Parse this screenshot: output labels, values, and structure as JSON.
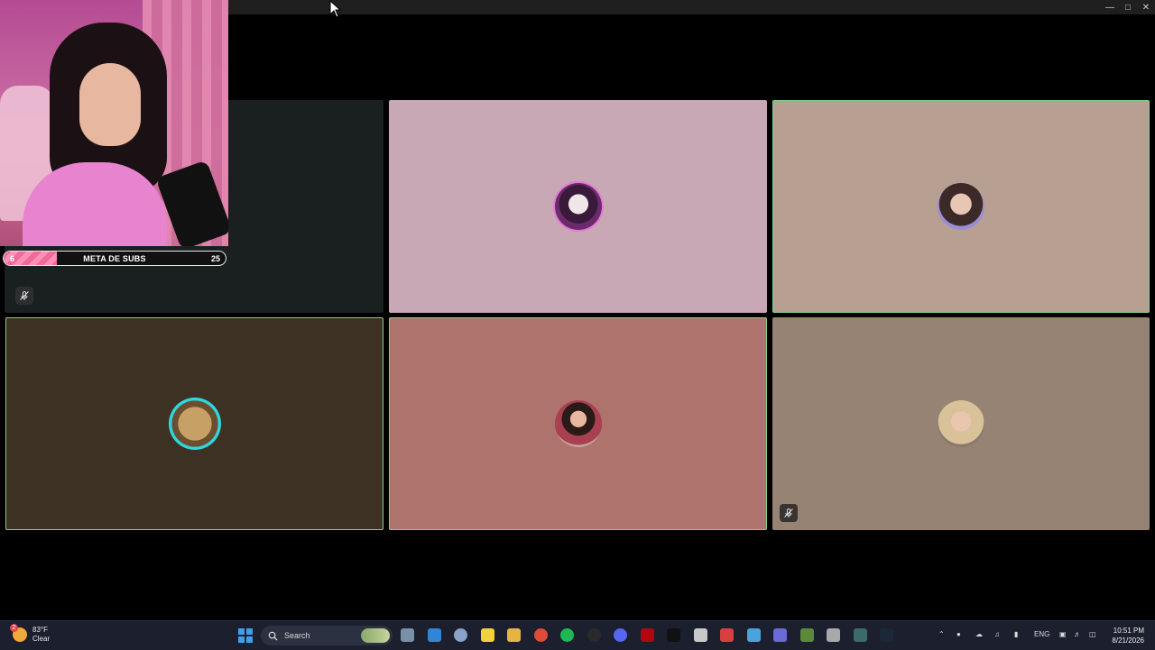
{
  "overlay": {
    "subgoal": {
      "current": "6",
      "label": "META DE SUBS",
      "goal": "25",
      "progress_fraction": 0.24
    }
  },
  "window": {
    "controls": [
      "minimize",
      "maximize",
      "close"
    ]
  },
  "call_grid": {
    "tiles": [
      {
        "name": "tile-1",
        "bg": "#1a1f1f",
        "speaking": false,
        "muted": true
      },
      {
        "name": "tile-2",
        "bg": "#c9a8b5",
        "speaking": false,
        "muted": false,
        "avatar": "purple-avatar"
      },
      {
        "name": "tile-3",
        "bg": "#b7a092",
        "speaking": true,
        "muted": false,
        "avatar": "girl-sparkle-avatar"
      },
      {
        "name": "tile-4",
        "bg": "#3c3122",
        "speaking": true,
        "muted": false,
        "avatar": "teddy-bear-avatar"
      },
      {
        "name": "tile-5",
        "bg": "#af736e",
        "speaking": true,
        "muted": false,
        "avatar": "girl-red-avatar"
      },
      {
        "name": "tile-6",
        "bg": "#978373",
        "speaking": false,
        "muted": true,
        "avatar": "girl-blonde-avatar"
      }
    ],
    "speaking_color": "#7fd48a"
  },
  "taskbar": {
    "weather": {
      "temp": "83°F",
      "condition": "Clear",
      "badge": "2"
    },
    "search_placeholder": "Search",
    "language": "ENG",
    "time": "10:51 PM",
    "date": "8/21/2026",
    "apps": [
      "file-explorer-icon",
      "store-icon",
      "settings-icon",
      "sticky-notes-icon",
      "folder-icon",
      "chrome-icon",
      "spotify-icon",
      "obs-icon",
      "discord-icon",
      "netflix-icon",
      "tiktok-icon",
      "app-icon",
      "voicemod-icon",
      "photos-icon",
      "game-icon",
      "minecraft-icon",
      "calculator-icon",
      "terminal-icon",
      "steam-icon"
    ]
  }
}
